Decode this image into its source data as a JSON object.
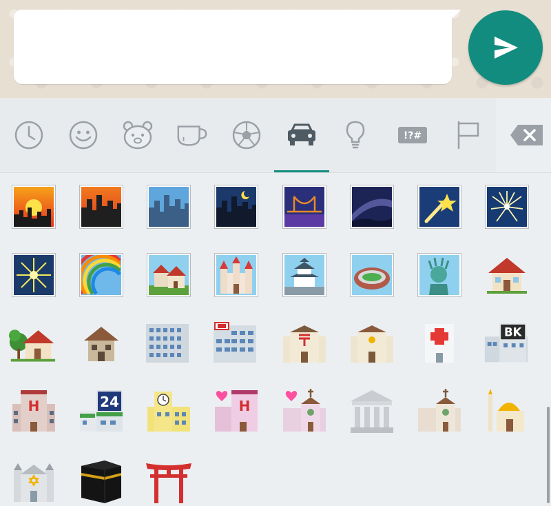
{
  "input": {
    "value": "",
    "send_icon": "send-arrow-icon"
  },
  "tabs": [
    {
      "name": "recent",
      "icon": "clock-icon",
      "active": false
    },
    {
      "name": "smileys",
      "icon": "smiley-icon",
      "active": false
    },
    {
      "name": "animals",
      "icon": "bear-icon",
      "active": false
    },
    {
      "name": "food",
      "icon": "cup-icon",
      "active": false
    },
    {
      "name": "activity",
      "icon": "soccer-ball-icon",
      "active": false
    },
    {
      "name": "travel",
      "icon": "car-icon",
      "active": true
    },
    {
      "name": "objects",
      "icon": "lightbulb-icon",
      "active": false
    },
    {
      "name": "symbols",
      "icon": "symbols-icon",
      "label": "!?#",
      "active": false
    },
    {
      "name": "flags",
      "icon": "flag-icon",
      "active": false
    }
  ],
  "backspace_icon": "backspace-icon",
  "colors": {
    "accent": "#128c7e",
    "tab_icon": "#9aa0a6",
    "active_tab_icon": "#4f5b62"
  },
  "emojis": [
    "sunset-over-buildings",
    "cityscape-at-dusk",
    "cityscape",
    "night-with-stars",
    "bridge-at-night",
    "milky-way",
    "shooting-star",
    "sparkler",
    "fireworks",
    "rainbow",
    "houses",
    "european-castle",
    "japanese-castle",
    "stadium",
    "statue-of-liberty",
    "house",
    "house-with-garden",
    "derelict-house",
    "office-building",
    "department-store",
    "japanese-post-office",
    "post-office",
    "hospital",
    "bank",
    "hotel",
    "convenience-store",
    "school",
    "love-hotel",
    "wedding",
    "classical-building",
    "church",
    "mosque",
    "synagogue",
    "kaaba",
    "shinto-shrine"
  ],
  "emoji_text": {
    "bank": "BK",
    "store": "24",
    "hotel": "H",
    "love_hotel": "H"
  }
}
